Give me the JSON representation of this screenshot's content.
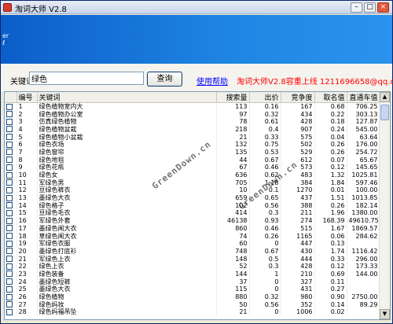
{
  "window": {
    "title": "淘词大师 V2.8"
  },
  "banner": {
    "text_line1": "er",
    "text_line2": "ℓ"
  },
  "toolbar": {
    "keyword_label": "关键词",
    "keyword_value": "绿色",
    "query_button": "查询",
    "help_link": "使用帮助",
    "promo_text": "淘词大师V2.8容重上线 1211696658@qq.com"
  },
  "watermark": "GreenDown.cn",
  "table": {
    "headers": [
      "编号",
      "关键词",
      "搜索量",
      "出价",
      "竞争度",
      "取名值",
      "直通车值"
    ],
    "rows": [
      [
        "1",
        "绿色植物室内大",
        "113",
        "0.16",
        "167",
        "0.68",
        "706.25"
      ],
      [
        "2",
        "绿色植物办公室",
        "97",
        "0.32",
        "434",
        "0.22",
        "303.13"
      ],
      [
        "3",
        "仿真绿色植物",
        "78",
        "0.61",
        "428",
        "0.18",
        "127.87"
      ],
      [
        "4",
        "绿色植物盆栽",
        "218",
        "0.4",
        "907",
        "0.24",
        "545.00"
      ],
      [
        "5",
        "绿色植物小盆栽",
        "21",
        "0.33",
        "575",
        "0.04",
        "63.64"
      ],
      [
        "6",
        "绿色衣场",
        "132",
        "0.75",
        "502",
        "0.26",
        "176.00"
      ],
      [
        "7",
        "绿色窗帘",
        "135",
        "0.53",
        "529",
        "0.26",
        "254.72"
      ],
      [
        "8",
        "绿色地毯",
        "44",
        "0.67",
        "612",
        "0.07",
        "65.67"
      ],
      [
        "9",
        "绿色花瓶",
        "67",
        "0.46",
        "573",
        "0.12",
        "145.65"
      ],
      [
        "10",
        "绿色女",
        "636",
        "0.62",
        "483",
        "1.32",
        "1025.81"
      ],
      [
        "11",
        "军绿色男",
        "705",
        "1.18",
        "384",
        "1.84",
        "597.46"
      ],
      [
        "12",
        "豆绿色裤衣",
        "10",
        "0.1",
        "1270",
        "0.01",
        "100.00"
      ],
      [
        "13",
        "墨绿色大衣",
        "659",
        "0.65",
        "437",
        "1.51",
        "1013.85"
      ],
      [
        "14",
        "绿色格子",
        "102",
        "0.56",
        "388",
        "0.26",
        "182.14"
      ],
      [
        "15",
        "豆绿色毛衣",
        "414",
        "0.3",
        "211",
        "1.96",
        "1380.00"
      ],
      [
        "16",
        "军绿色外套",
        "46138",
        "0.93",
        "274",
        "168.39",
        "49610.75"
      ],
      [
        "17",
        "墨绿色闻大衣",
        "860",
        "0.46",
        "515",
        "1.67",
        "1869.57"
      ],
      [
        "18",
        "草绿色闻大衣",
        "74",
        "0.26",
        "1165",
        "0.06",
        "284.62"
      ],
      [
        "19",
        "军绿色衣服",
        "60",
        "0",
        "447",
        "0.13",
        ""
      ],
      [
        "20",
        "墨绿色打底衫",
        "748",
        "0.67",
        "430",
        "1.74",
        "1116.42"
      ],
      [
        "21",
        "军绿色上衣",
        "148",
        "0.5",
        "444",
        "0.33",
        "296.00"
      ],
      [
        "22",
        "绿色上衣",
        "52",
        "0.3",
        "428",
        "0.12",
        "173.33"
      ],
      [
        "23",
        "绿色装备",
        "144",
        "1",
        "210",
        "0.69",
        "144.00"
      ],
      [
        "24",
        "墨绿色短裤",
        "37",
        "0",
        "327",
        "0.11",
        ""
      ],
      [
        "25",
        "墨绿色大衣",
        "115",
        "0",
        "431",
        "0.27",
        ""
      ],
      [
        "26",
        "绿色植物",
        "880",
        "0.32",
        "980",
        "0.90",
        "2750.00"
      ],
      [
        "27",
        "绿色妈妆",
        "50",
        "0.56",
        "352",
        "0.14",
        "89.29"
      ],
      [
        "28",
        "绿色妈福吊坠",
        "21",
        "0",
        "1006",
        "0.02",
        ""
      ]
    ]
  }
}
